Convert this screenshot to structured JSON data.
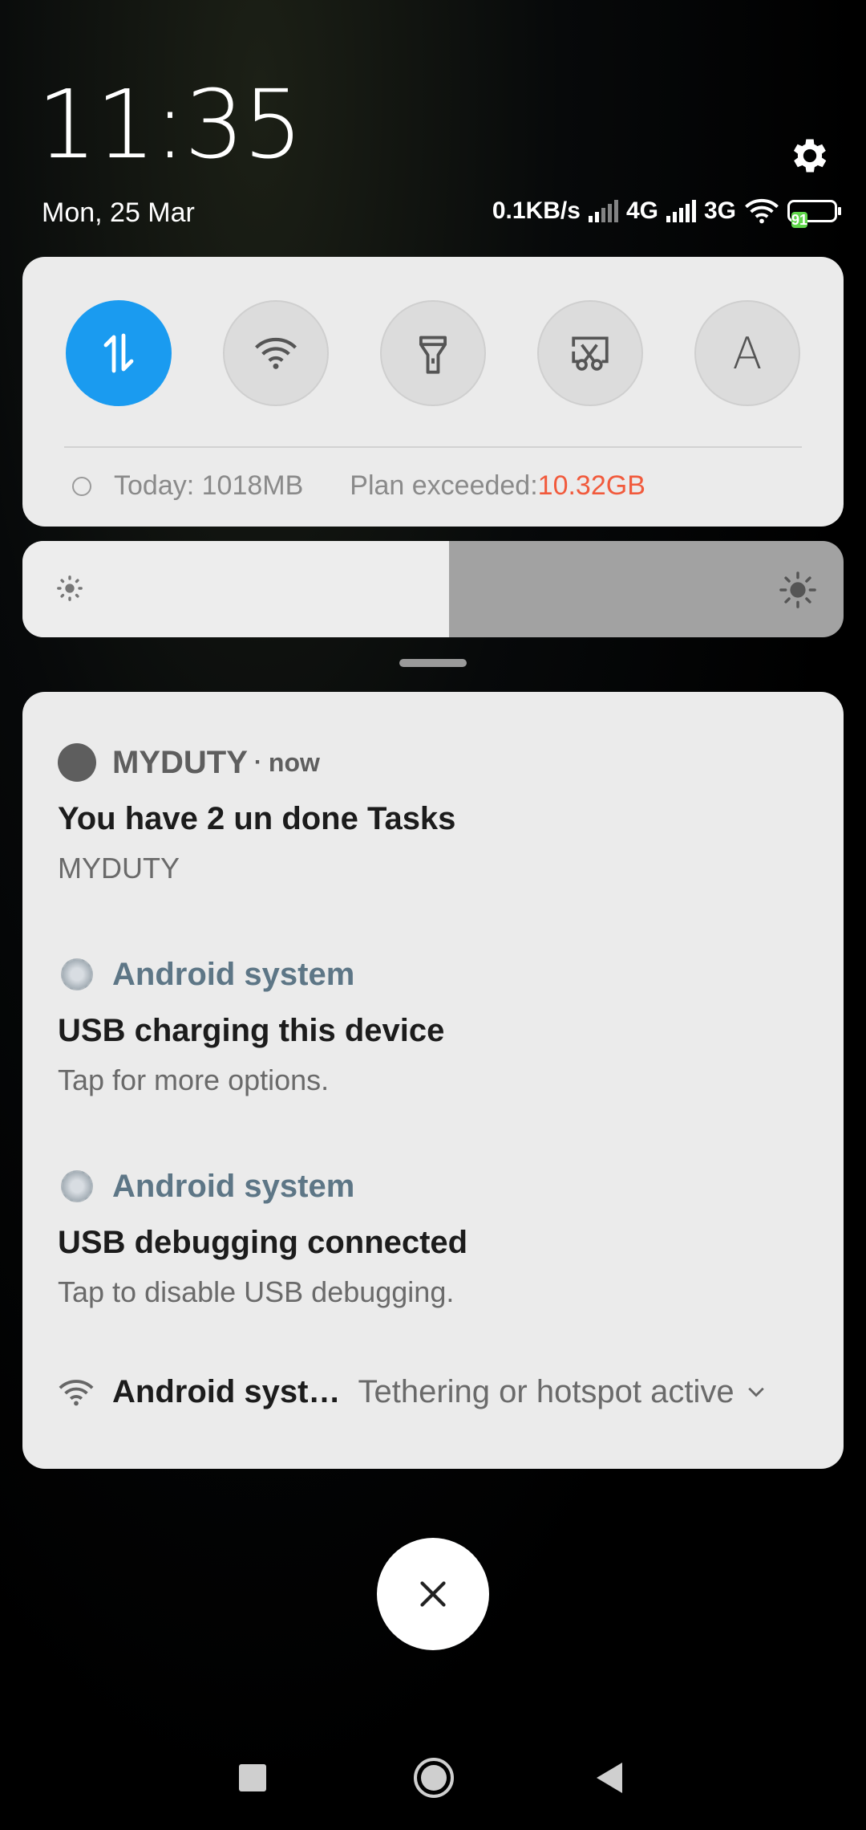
{
  "status": {
    "time": "11:35",
    "date": "Mon, 25 Mar",
    "net_speed": "0.1KB/s",
    "network_1": "4G",
    "network_2": "3G",
    "battery": "91"
  },
  "quick_settings": {
    "tiles": [
      {
        "name": "mobile-data",
        "active": true
      },
      {
        "name": "wifi",
        "active": false
      },
      {
        "name": "flashlight",
        "active": false
      },
      {
        "name": "screenshot",
        "active": false
      },
      {
        "name": "auto-brightness",
        "active": false,
        "glyph": "A"
      }
    ],
    "data_today": "Today: 1018MB",
    "plan_label": "Plan exceeded: ",
    "plan_value": "10.32GB",
    "colors": {
      "active": "#1a9bf0",
      "warning": "#f15a3c"
    }
  },
  "brightness": {
    "level": 0.52
  },
  "notifications": [
    {
      "app": "MYDUTY",
      "time": "now",
      "title": "You have 2 un done Tasks",
      "body": "MYDUTY"
    },
    {
      "app": "Android system",
      "title": "USB charging this device",
      "body": "Tap for more options."
    },
    {
      "app": "Android system",
      "title": "USB debugging connected",
      "body": "Tap to disable USB debugging."
    }
  ],
  "compact_notification": {
    "app": "Android syst…",
    "text": "Tethering or hotspot active"
  }
}
